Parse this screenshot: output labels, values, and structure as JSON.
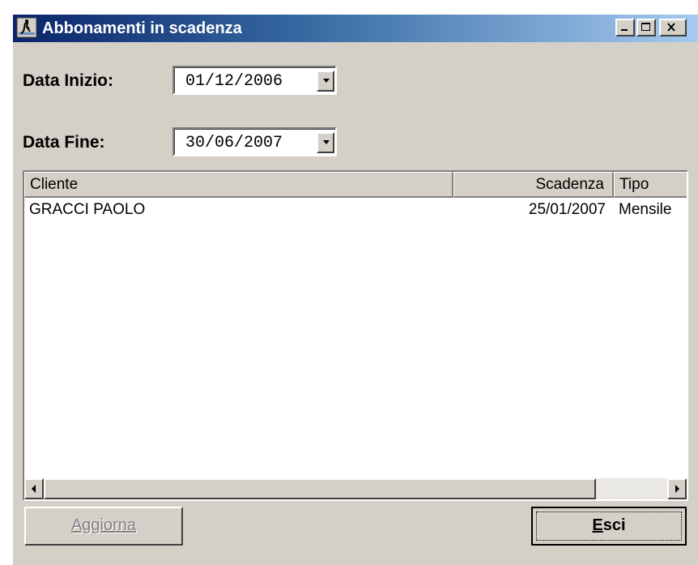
{
  "window": {
    "title": "Abbonamenti in scadenza",
    "icon": "app-icon",
    "controls": [
      "minimize-icon",
      "maximize-icon",
      "close-icon"
    ]
  },
  "filters": {
    "start": {
      "label": "Data Inizio:",
      "value": "01/12/2006"
    },
    "end": {
      "label": "Data Fine:",
      "value": "30/06/2007"
    }
  },
  "list": {
    "columns": [
      "Cliente",
      "Scadenza",
      "Tipo"
    ],
    "rows": [
      {
        "cliente": "GRACCI PAOLO",
        "scadenza": "25/01/2007",
        "tipo": "Mensile"
      }
    ]
  },
  "buttons": {
    "update": {
      "label": "Aggiorna",
      "state": "disabled"
    },
    "exit": {
      "label": "Esci",
      "state": "default"
    }
  },
  "colors": {
    "face": "#d4d0c8",
    "title_start": "#0a246a",
    "title_end": "#a6caf0"
  }
}
